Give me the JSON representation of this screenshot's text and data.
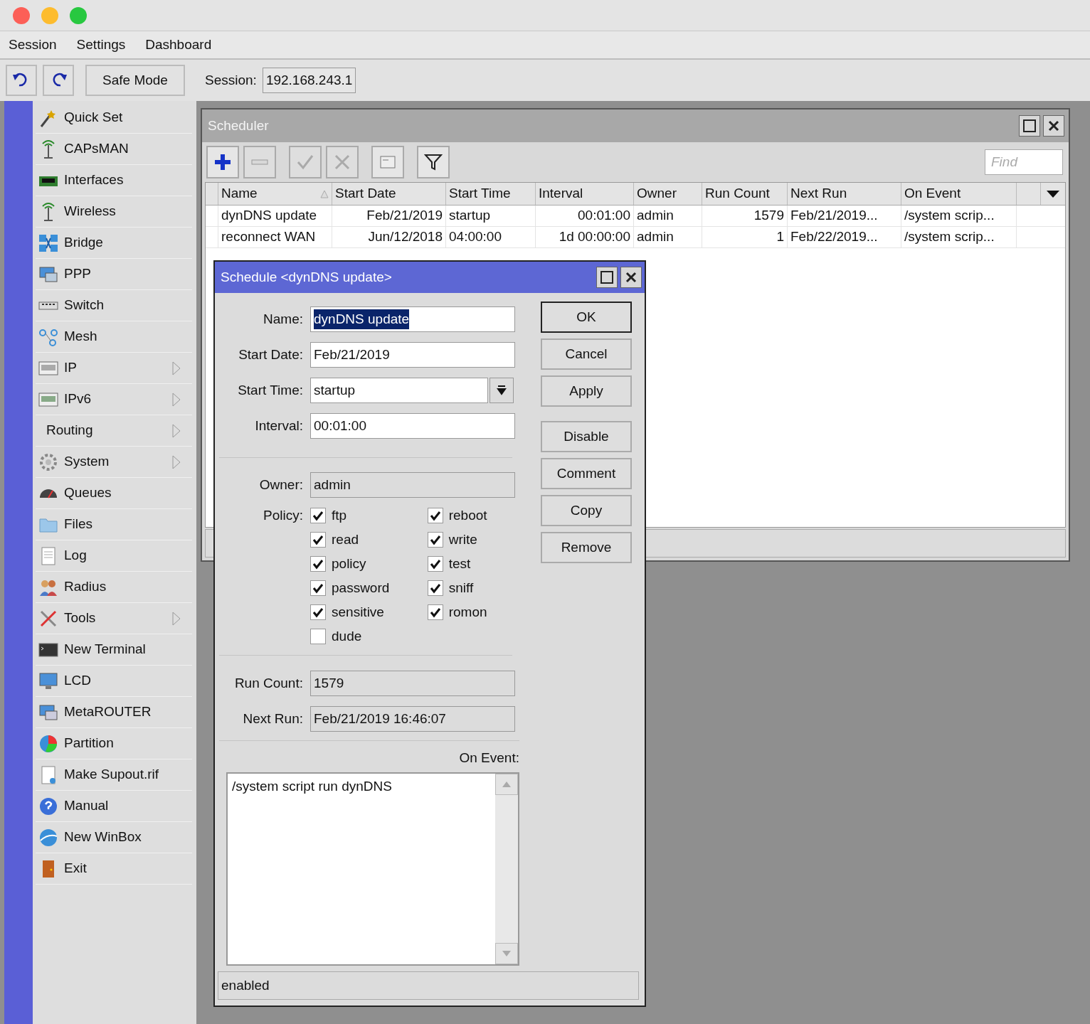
{
  "menu": [
    {
      "label": "Session"
    },
    {
      "label": "Settings"
    },
    {
      "label": "Dashboard"
    }
  ],
  "toolbar": {
    "safe_mode": "Safe Mode",
    "session_label": "Session:",
    "session_value": "192.168.243.1"
  },
  "sidebar": {
    "items": [
      {
        "label": "Quick Set",
        "submenu": false
      },
      {
        "label": "CAPsMAN",
        "submenu": false
      },
      {
        "label": "Interfaces",
        "submenu": false
      },
      {
        "label": "Wireless",
        "submenu": false
      },
      {
        "label": "Bridge",
        "submenu": false
      },
      {
        "label": "PPP",
        "submenu": false
      },
      {
        "label": "Switch",
        "submenu": false
      },
      {
        "label": "Mesh",
        "submenu": false
      },
      {
        "label": "IP",
        "submenu": true
      },
      {
        "label": "IPv6",
        "submenu": true
      },
      {
        "label": "Routing",
        "submenu": true
      },
      {
        "label": "System",
        "submenu": true
      },
      {
        "label": "Queues",
        "submenu": false
      },
      {
        "label": "Files",
        "submenu": false
      },
      {
        "label": "Log",
        "submenu": false
      },
      {
        "label": "Radius",
        "submenu": false
      },
      {
        "label": "Tools",
        "submenu": true
      },
      {
        "label": "New Terminal",
        "submenu": false
      },
      {
        "label": "LCD",
        "submenu": false
      },
      {
        "label": "MetaROUTER",
        "submenu": false
      },
      {
        "label": "Partition",
        "submenu": false
      },
      {
        "label": "Make Supout.rif",
        "submenu": false
      },
      {
        "label": "Manual",
        "submenu": false
      },
      {
        "label": "New WinBox",
        "submenu": false
      },
      {
        "label": "Exit",
        "submenu": false
      }
    ]
  },
  "scheduler": {
    "title": "Scheduler",
    "find_placeholder": "Find",
    "tools": [
      {
        "kind": "add",
        "disabled": false
      },
      {
        "kind": "remove",
        "disabled": true
      },
      {
        "kind": "enable",
        "disabled": true
      },
      {
        "kind": "disable",
        "disabled": true
      },
      {
        "kind": "comment",
        "disabled": false
      },
      {
        "kind": "filter",
        "disabled": false
      }
    ],
    "columns": [
      {
        "label": "Name",
        "sorted": true
      },
      {
        "label": "Start Date",
        "sorted": false
      },
      {
        "label": "Start Time",
        "sorted": false
      },
      {
        "label": "Interval",
        "sorted": false
      },
      {
        "label": "Owner",
        "sorted": false
      },
      {
        "label": "Run Count",
        "sorted": false
      },
      {
        "label": "Next Run",
        "sorted": false
      },
      {
        "label": "On Event",
        "sorted": false
      }
    ],
    "rows": [
      {
        "cells": [
          "dynDNS update",
          "Feb/21/2019",
          "startup",
          "00:01:00",
          "admin",
          "1579",
          "Feb/21/2019...",
          "/system scrip..."
        ]
      },
      {
        "cells": [
          "reconnect WAN",
          "Jun/12/2018",
          "04:00:00",
          "1d 00:00:00",
          "admin",
          "1",
          "Feb/22/2019...",
          "/system scrip..."
        ]
      }
    ]
  },
  "dialog": {
    "title": "Schedule <dynDNS update>",
    "fields": [
      {
        "label": "Name:",
        "value": "dynDNS update",
        "kind": "text",
        "highlighted": true
      },
      {
        "label": "Start Date:",
        "value": "Feb/21/2019",
        "kind": "text",
        "highlighted": false
      },
      {
        "label": "Start Time:",
        "value": "startup",
        "kind": "select",
        "highlighted": false
      },
      {
        "label": "Interval:",
        "value": "00:01:00",
        "kind": "text",
        "highlighted": false
      }
    ],
    "owner": {
      "label": "Owner:",
      "value": "admin"
    },
    "policy_label": "Policy:",
    "policies": [
      {
        "label": "ftp",
        "checked": true
      },
      {
        "label": "read",
        "checked": true
      },
      {
        "label": "policy",
        "checked": true
      },
      {
        "label": "password",
        "checked": true
      },
      {
        "label": "sensitive",
        "checked": true
      },
      {
        "label": "dude",
        "checked": false
      },
      {
        "label": "reboot",
        "checked": true
      },
      {
        "label": "write",
        "checked": true
      },
      {
        "label": "test",
        "checked": true
      },
      {
        "label": "sniff",
        "checked": true
      },
      {
        "label": "romon",
        "checked": true
      }
    ],
    "info": [
      {
        "label": "Run Count:",
        "value": "1579"
      },
      {
        "label": "Next Run:",
        "value": "Feb/21/2019 16:46:07"
      }
    ],
    "on_event_label": "On Event:",
    "on_event": "/system script run dynDNS",
    "buttons": [
      {
        "label": "OK",
        "default": true
      },
      {
        "label": "Cancel",
        "default": false
      },
      {
        "label": "Apply",
        "default": false
      },
      {
        "label": "Disable",
        "default": false
      },
      {
        "label": "Comment",
        "default": false
      },
      {
        "label": "Copy",
        "default": false
      },
      {
        "label": "Remove",
        "default": false
      }
    ],
    "status": "enabled"
  }
}
